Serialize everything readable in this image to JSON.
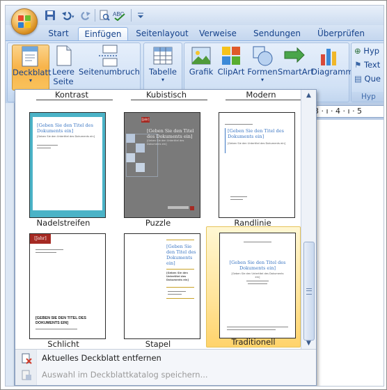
{
  "tabs": [
    "Start",
    "Einfügen",
    "Seitenlayout",
    "Verweise",
    "Sendungen",
    "Überprüfen"
  ],
  "active_tab": "Einfügen",
  "ribbon": {
    "pages_group": {
      "cover_page": "Deckblatt",
      "blank_page_1": "Leere",
      "blank_page_2": "Seite",
      "page_break": "Seitenumbruch"
    },
    "tables_group": {
      "table": "Tabelle"
    },
    "illustrations_group": {
      "picture": "Grafik",
      "clipart": "ClipArt",
      "shapes": "Formen",
      "smartart": "SmartArt",
      "chart": "Diagramm"
    },
    "links_group": {
      "hyperlink": "Hyp",
      "bookmark": "Text",
      "cross_ref": "Que",
      "label": "Hyp"
    }
  },
  "ruler_marks": "· 3 · ı · 4 · ı · 5",
  "gallery": {
    "top_labels": [
      "Kontrast",
      "Kubistisch",
      "Modern"
    ],
    "items": [
      {
        "label": "Nadelstreifen",
        "title": "[Geben Sie den Titel des Dokuments ein]",
        "subtitle": "[Geben Sie den Untertitel des Dokuments ein]"
      },
      {
        "label": "Puzzle",
        "title": "[Geben Sie den Titel des Dokuments ein]",
        "subtitle": "[Geben Sie den Untertitel des Dokuments ein]",
        "tag": "[Jahr]"
      },
      {
        "label": "Randlinie",
        "title": "[Geben Sie den Titel des Dokuments ein]",
        "subtitle": "[Geben Sie den Untertitel des Dokuments ein]"
      },
      {
        "label": "Schlicht",
        "title": "[GEBEN SIE DEN TITEL DES DOKUMENTS EIN]",
        "tag": "[Jahr]"
      },
      {
        "label": "Stapel",
        "title": "[Geben Sie den Titel des Dokuments ein]",
        "subtitle": "[Geben Sie den Untertitel des Dokuments ein]"
      },
      {
        "label": "Traditionell",
        "title": "[Geben Sie den Titel des Dokuments ein]",
        "subtitle": "[Geben Sie den Untertitel des Dokuments ein]"
      }
    ],
    "selected": "Traditionell",
    "menu": {
      "remove": "Aktuelles Deckblatt entfernen",
      "save": "Auswahl im Deckblattkatalog speichern..."
    }
  },
  "colors": {
    "accent_blue": "#15428b",
    "cover_teal": "#4bb3c7",
    "cover_red": "#a52a23",
    "selection": "#ffd36b"
  }
}
